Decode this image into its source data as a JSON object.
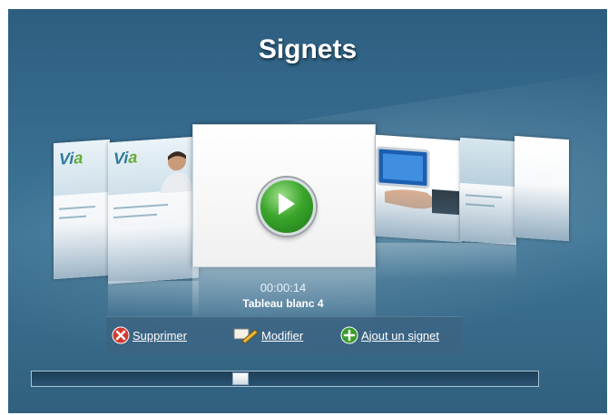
{
  "title": "Signets",
  "current_bookmark": {
    "timecode": "00:00:14",
    "title": "Tableau blanc 4"
  },
  "thumbnails": [
    {
      "logo": "Via"
    },
    {
      "logo": "Via"
    }
  ],
  "toolbar": {
    "delete_label": "Supprimer",
    "edit_label": "Modifier",
    "add_label": "Ajout un signet"
  },
  "slider": {
    "position": 0.41
  },
  "colors": {
    "background": "#366b8e",
    "play_green": "#3aa52b",
    "delete_red": "#d23a2e",
    "add_green": "#3b9a2d"
  }
}
